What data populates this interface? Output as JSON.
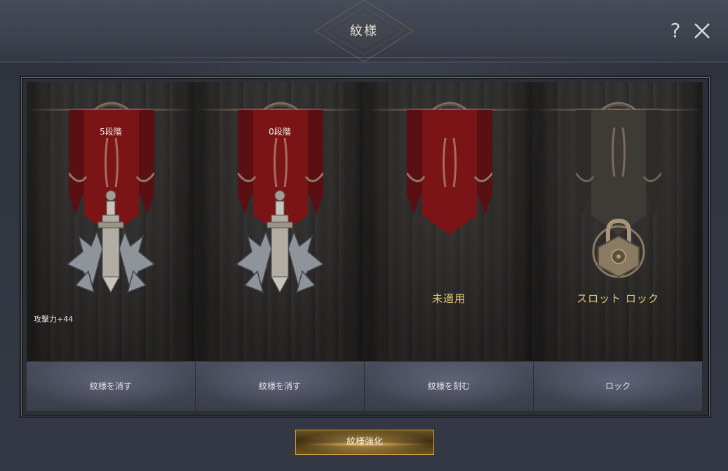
{
  "dialog": {
    "title": "紋様",
    "help_label": "?"
  },
  "slots": [
    {
      "banner_label": "5段階",
      "stat": "攻撃力+44",
      "status": "",
      "state": "equipped",
      "action_label": "紋様を消す"
    },
    {
      "banner_label": "0段階",
      "stat": "",
      "status": "",
      "state": "equipped",
      "action_label": "紋様を消す"
    },
    {
      "banner_label": "",
      "stat": "",
      "status": "未適用",
      "state": "empty",
      "action_label": "紋様を刻む"
    },
    {
      "banner_label": "",
      "stat": "",
      "status": "スロット ロック",
      "state": "locked",
      "action_label": "ロック"
    }
  ],
  "enhance_button": {
    "label": "紋様強化"
  },
  "colors": {
    "banner_red": "#7a1416",
    "banner_gray": "#3e3a36",
    "gold_text": "#e1c77c",
    "gold_border": "#c8a24c"
  }
}
